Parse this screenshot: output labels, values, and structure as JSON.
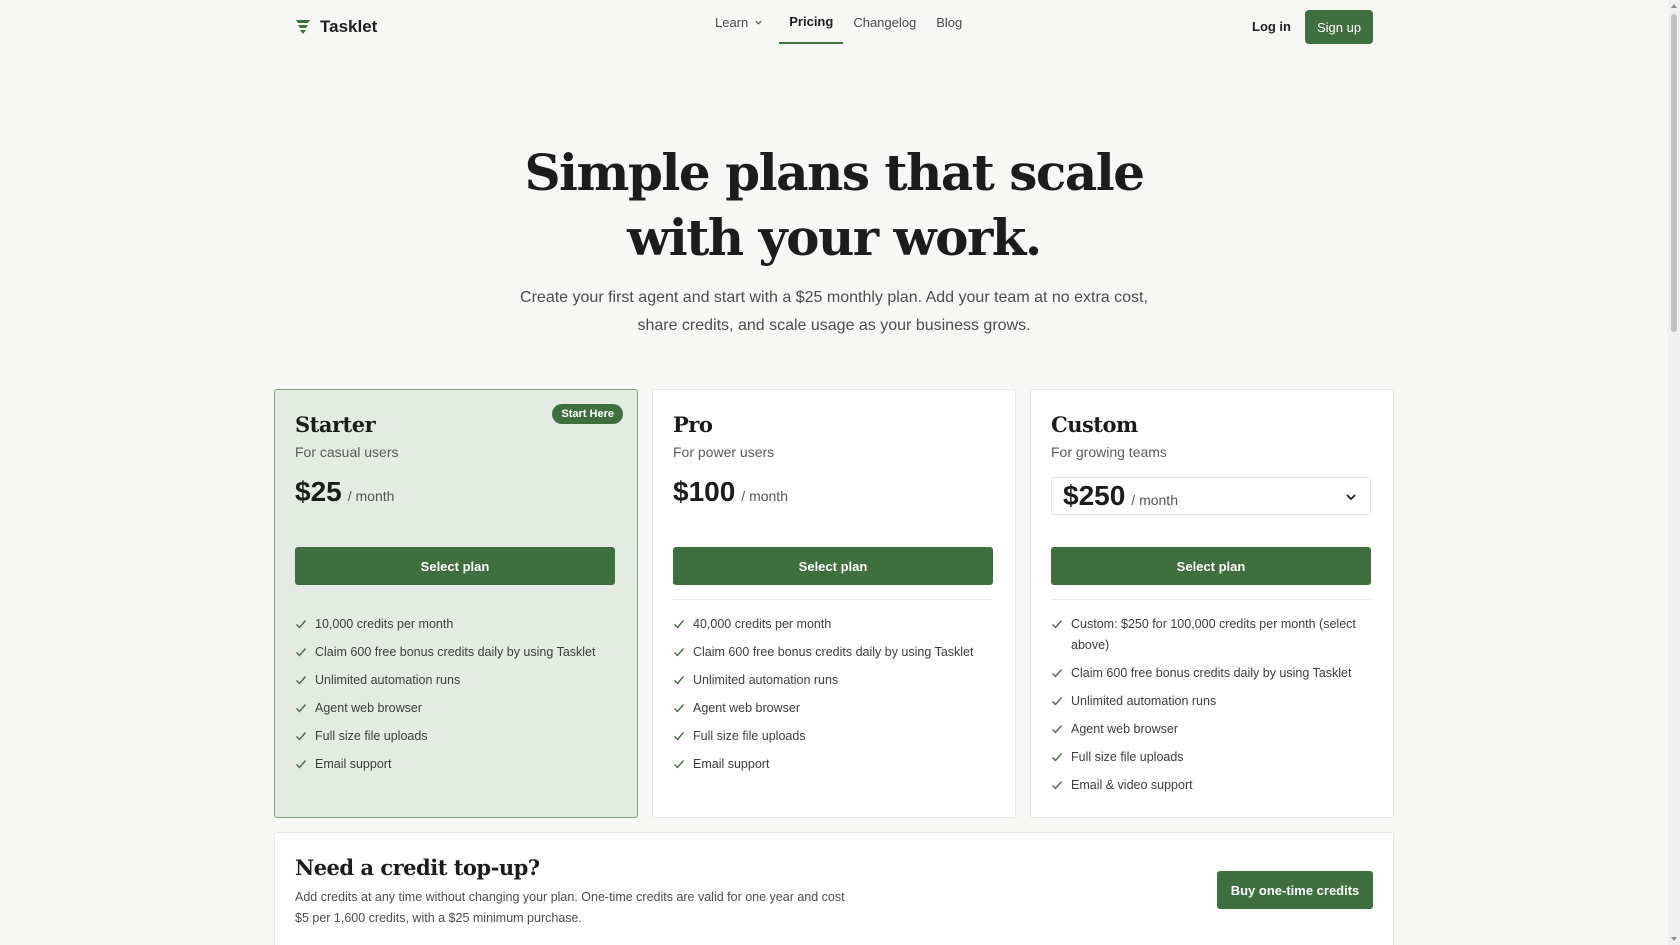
{
  "nav": {
    "brand": "Tasklet",
    "links": [
      "Learn",
      "Pricing",
      "Changelog",
      "Blog"
    ],
    "active": "Pricing",
    "login": "Log in",
    "signup": "Sign up"
  },
  "hero": {
    "title_line1": "Simple plans that scale",
    "title_line2": "with your work.",
    "subtitle_line1": "Create your first agent and start with a $25 monthly plan. Add your team at no extra cost,",
    "subtitle_line2": "share credits, and scale usage as your business grows."
  },
  "plans": [
    {
      "name": "Starter",
      "audience": "For casual users",
      "badge": "Start Here",
      "price": "$25",
      "period": "/ month",
      "cta": "Select plan",
      "features": [
        "10,000 credits per month",
        "Claim 600 free bonus credits daily by using Tasklet",
        "Unlimited automation runs",
        "Agent web browser",
        "Full size file uploads",
        "Email support"
      ]
    },
    {
      "name": "Pro",
      "audience": "For power users",
      "price": "$100",
      "period": "/ month",
      "cta": "Select plan",
      "features": [
        "40,000 credits per month",
        "Claim 600 free bonus credits daily by using Tasklet",
        "Unlimited automation runs",
        "Agent web browser",
        "Full size file uploads",
        "Email support"
      ]
    },
    {
      "name": "Custom",
      "audience": "For growing teams",
      "price": "$250",
      "period": "/ month",
      "cta": "Select plan",
      "features": [
        "Custom: $250 for 100,000 credits per month (select above)",
        "Claim 600 free bonus credits daily by using Tasklet",
        "Unlimited automation runs",
        "Agent web browser",
        "Full size file uploads",
        "Email & video support"
      ]
    }
  ],
  "topup": {
    "title": "Need a credit top-up?",
    "desc_line1": "Add credits at any time without changing your plan. One-time credits are valid for one year and cost",
    "desc_line2": "$5 per 1,600 credits, with a $25 minimum purchase.",
    "cta": "Buy one-time credits"
  },
  "colors": {
    "accent": "#3f6e3f",
    "starter_bg": "#e4ebe2",
    "page_bg": "#f7f7f6"
  },
  "icons": [
    "logo-icon",
    "chevron-down-icon",
    "check-icon"
  ]
}
